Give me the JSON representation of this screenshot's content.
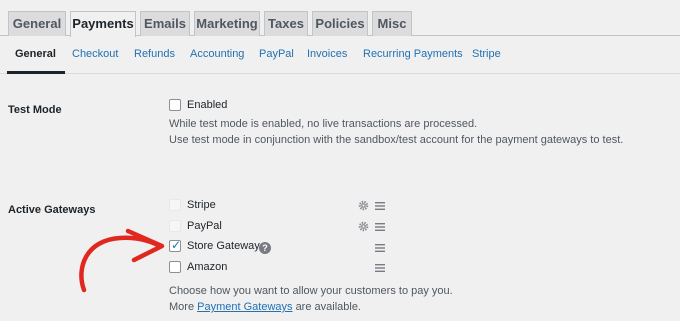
{
  "top_tabs": [
    "General",
    "Payments",
    "Emails",
    "Marketing",
    "Taxes",
    "Policies",
    "Misc"
  ],
  "sub_tabs": [
    "General",
    "Checkout",
    "Refunds",
    "Accounting",
    "PayPal",
    "Invoices",
    "Recurring Payments",
    "Stripe"
  ],
  "test_mode": {
    "label": "Test Mode",
    "checkbox_label": "Enabled",
    "checked": false,
    "desc_line1": "While test mode is enabled, no live transactions are processed.",
    "desc_line2": "Use test mode in conjunction with the sandbox/test account for the payment gateways to test."
  },
  "gateways": {
    "label": "Active Gateways",
    "items": [
      {
        "name": "Stripe",
        "checked": false,
        "has_settings": true
      },
      {
        "name": "PayPal",
        "checked": false,
        "has_settings": true
      },
      {
        "name": "Store Gateway",
        "checked": true,
        "has_help": true
      },
      {
        "name": "Amazon",
        "checked": false
      }
    ],
    "desc_line1": "Choose how you want to allow your customers to pay you.",
    "desc_more_prefix": "More",
    "desc_link": "Payment Gateways",
    "desc_more_suffix": "are available."
  },
  "colors": {
    "accent": "#2271b1",
    "annotation_arrow": "#e0281e"
  }
}
